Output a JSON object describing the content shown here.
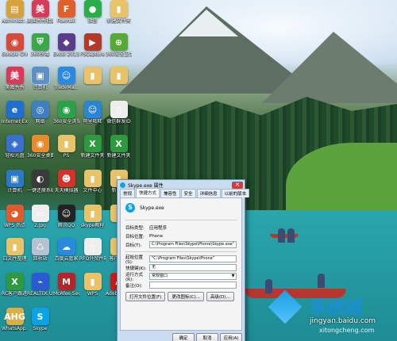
{
  "desktop_icons": [
    {
      "label": "Administr...",
      "color": "#d8a23a",
      "glyph": "▤"
    },
    {
      "label": "美图秀秀批处理",
      "color": "#d53c5a",
      "glyph": "美"
    },
    {
      "label": "Foxmail",
      "color": "#e0602a",
      "glyph": "F"
    },
    {
      "label": "微信",
      "color": "#2aae4a",
      "glyph": "●"
    },
    {
      "label": "新建文件夹",
      "color": "#e8c36a",
      "glyph": "▮"
    },
    {
      "label": "Google Chrome",
      "color": "#d94a3b",
      "glyph": "◉"
    },
    {
      "label": "360杀毒",
      "color": "#3aa84a",
      "glyph": "⛨"
    },
    {
      "label": "Excel 2013",
      "color": "#5b3b8a",
      "glyph": "◆"
    },
    {
      "label": "FSCapture",
      "color": "#b33a2a",
      "glyph": "▶"
    },
    {
      "label": "360安全卫士",
      "color": "#55aa33",
      "glyph": "⊕"
    },
    {
      "label": "美图秀秀",
      "color": "#d53c5a",
      "glyph": "美"
    },
    {
      "label": "计算机",
      "color": "#5f8fc0",
      "glyph": "▣"
    },
    {
      "label": "TradeMa...",
      "color": "#2a8ae0",
      "glyph": "☺"
    },
    {
      "label": "",
      "color": "#e8c36a",
      "glyph": "▮"
    },
    {
      "label": "",
      "color": "#e8c36a",
      "glyph": "▮"
    },
    {
      "label": "Internet Explorer",
      "color": "#1e6fcf",
      "glyph": "e"
    },
    {
      "label": "网络",
      "color": "#3d7fbf",
      "glyph": "◎"
    },
    {
      "label": "360安全浏览器",
      "color": "#2aa24a",
      "glyph": "◉"
    },
    {
      "label": "阿里旺旺",
      "color": "#2a86d5",
      "glyph": "☺"
    },
    {
      "label": "微信群发ID",
      "color": "#eeeeee",
      "glyph": "▯"
    },
    {
      "label": "轻松光盘",
      "color": "#3a6fd0",
      "glyph": "◈"
    },
    {
      "label": "360安全桌面",
      "color": "#eb8a2a",
      "glyph": "◉"
    },
    {
      "label": "PS",
      "color": "#e8c36a",
      "glyph": "▮"
    },
    {
      "label": "新建文件夹",
      "color": "#2e9a3f",
      "glyph": "X"
    },
    {
      "label": "新建文件夹",
      "color": "#2e9a3f",
      "glyph": "X"
    },
    {
      "label": "计算机",
      "color": "#2a78c8",
      "glyph": "▣"
    },
    {
      "label": "一键还原系统",
      "color": "#3a3a3a",
      "glyph": "◐"
    },
    {
      "label": "天天模拟器",
      "color": "#d8302a",
      "glyph": "☻"
    },
    {
      "label": "文件中心",
      "color": "#e8c36a",
      "glyph": "▮"
    },
    {
      "label": "新建文",
      "color": "#e8c36a",
      "glyph": "▮"
    },
    {
      "label": "WPS 热点",
      "color": "#e35a2a",
      "glyph": "◕"
    },
    {
      "label": "2.jpg",
      "color": "#eeeeee",
      "glyph": "▭"
    },
    {
      "label": "腾讯QQ",
      "color": "#222222",
      "glyph": "☺"
    },
    {
      "label": "skype教程",
      "color": "#e8c36a",
      "glyph": "▮"
    },
    {
      "label": "",
      "color": "#e8c36a",
      "glyph": "▮"
    },
    {
      "label": "日文件整理",
      "color": "#e8c36a",
      "glyph": "▮"
    },
    {
      "label": "回收站",
      "color": "#b5c3d0",
      "glyph": "♺"
    },
    {
      "label": "百度云管家",
      "color": "#2a8ae0",
      "glyph": "☁"
    },
    {
      "label": "RFQ外贸件箱.txt",
      "color": "#eeeeee",
      "glyph": "▯"
    },
    {
      "label": "客户附件",
      "color": "#e8c36a",
      "glyph": "▮"
    },
    {
      "label": "RC客户跟进.xlsx",
      "color": "#2e9a3f",
      "glyph": "X"
    },
    {
      "label": "REALTEK USB Wir...",
      "color": "#2a5ad0",
      "glyph": "⌁"
    },
    {
      "label": "McAfee Security...",
      "color": "#b8232a",
      "glyph": "M"
    },
    {
      "label": "WPS",
      "color": "#e8c36a",
      "glyph": "▮"
    },
    {
      "label": "Adobe Reader XI",
      "color": "#cc1a1a",
      "glyph": "A"
    },
    {
      "label": "WhatsApp...",
      "color": "#d8b04a",
      "glyph": "AHG"
    },
    {
      "label": "Skype",
      "color": "#0aa3e6",
      "glyph": "S"
    }
  ],
  "window": {
    "title": "Skype.exe 属性",
    "close_glyph": "✕",
    "tabs": [
      "常规",
      "快捷方式",
      "兼容性",
      "安全",
      "详细信息",
      "以前的版本"
    ],
    "active_tab": 1,
    "app_glyph": "S",
    "app_name": "Skype.exe",
    "fields": {
      "target_type_label": "目标类型:",
      "target_type_value": "应用程序",
      "target_loc_label": "目标位置:",
      "target_loc_value": "Phone",
      "target_label": "目标(T):",
      "target_value": "C:\\Program Files\\Skype\\Phone\\Skype.exe\"",
      "startin_label": "起始位置(S):",
      "startin_value": "\"C:\\Program Files\\Skype\\Phone\"",
      "hotkey_label": "快捷键(K):",
      "hotkey_value": "无",
      "run_label": "运行方式(R):",
      "run_value": "常规窗口",
      "comment_label": "备注(O):",
      "comment_value": ""
    },
    "buttons": {
      "open_location": "打开文件位置(F)",
      "change_icon": "更改图标(C)...",
      "advanced": "高级(D)..."
    },
    "footer": {
      "ok": "确定",
      "cancel": "取消",
      "apply": "应用(A)"
    }
  },
  "watermark": {
    "brand": "系统城",
    "url": "jingyan.baidu.com",
    "site": "xitongcheng.com"
  }
}
